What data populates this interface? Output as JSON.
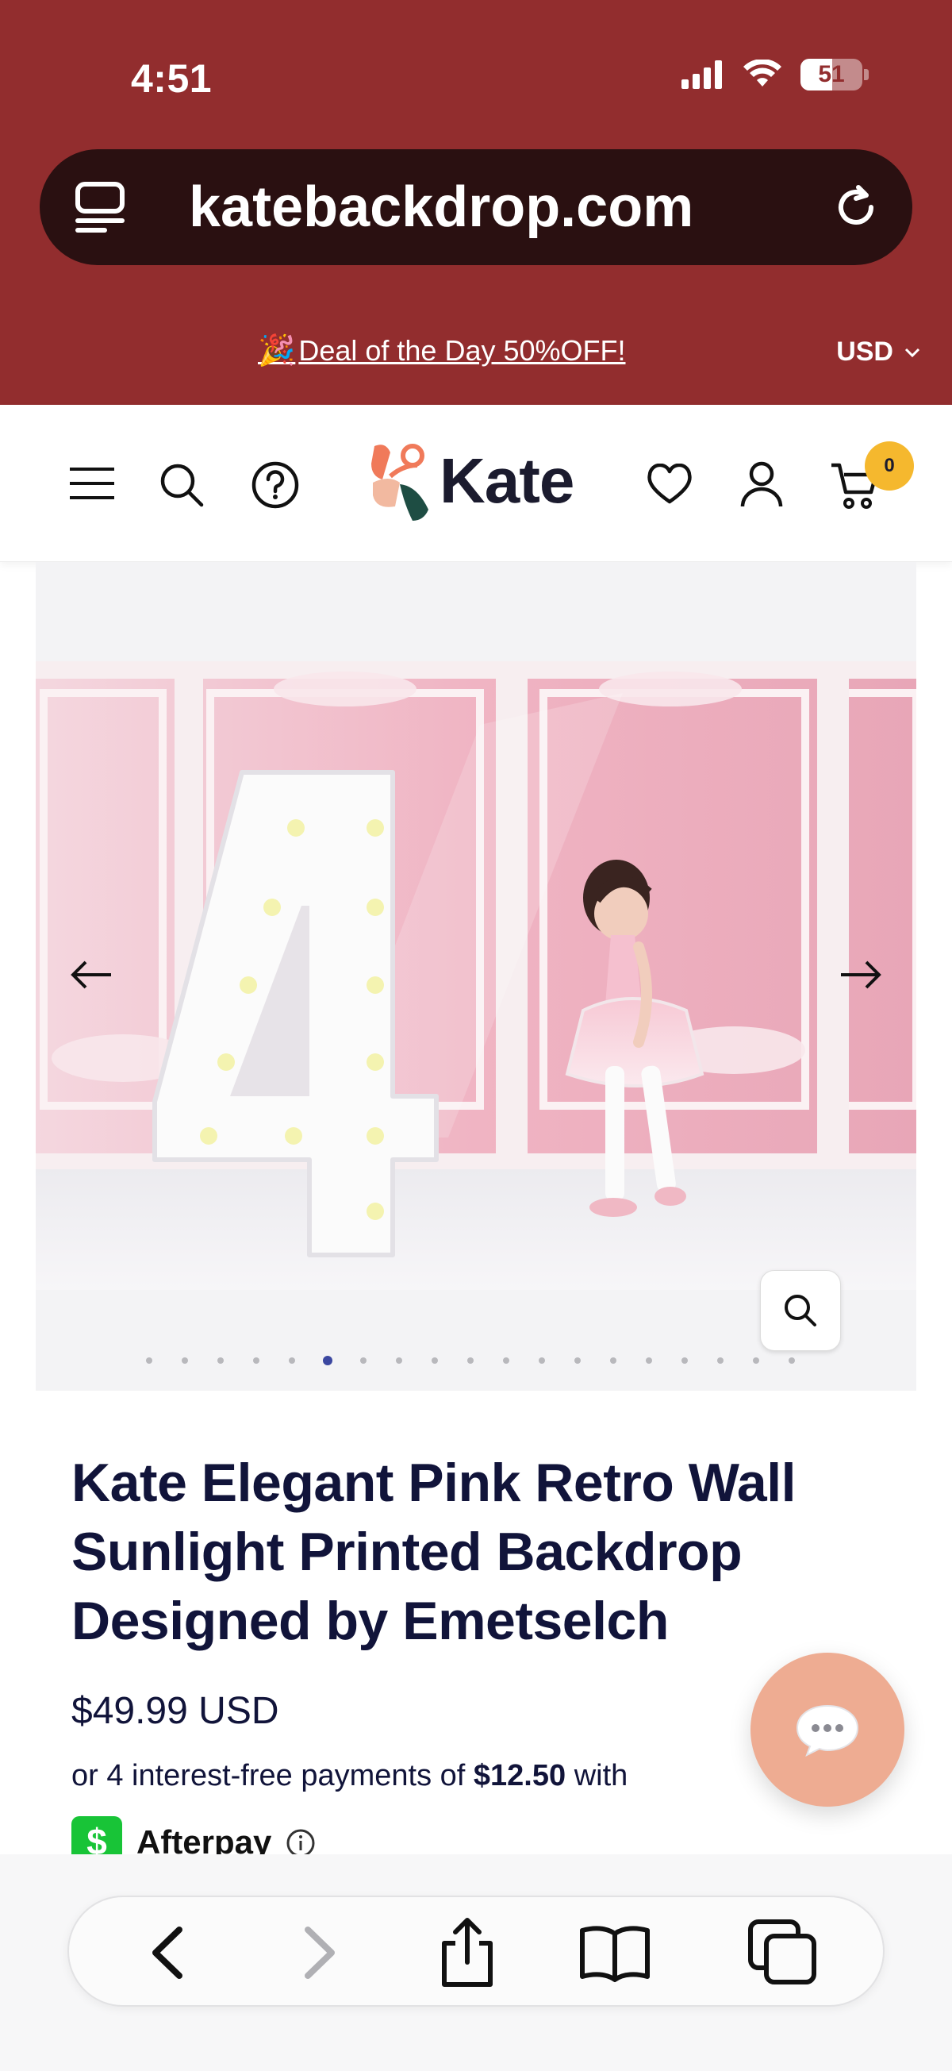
{
  "status_bar": {
    "time": "4:51",
    "battery_level": "51",
    "battery_fraction": 0.51,
    "icons": [
      "signal-icon",
      "wifi-icon",
      "battery-icon"
    ]
  },
  "browser": {
    "url": "katebackdrop.com",
    "icons": [
      "tab-overview-icon",
      "reload-icon"
    ]
  },
  "promo_bar": {
    "text": "Deal of the Day 50%OFF!",
    "emoji_icon": "party-popper-icon",
    "currency": "USD"
  },
  "header": {
    "logo_text": "Kate",
    "cart_count": "0",
    "icons": [
      "menu-icon",
      "search-icon",
      "help-icon",
      "wishlist-icon",
      "account-icon",
      "cart-icon"
    ]
  },
  "gallery": {
    "image_count": 19,
    "active_index": 5,
    "icons": [
      "arrow-left-icon",
      "arrow-right-icon",
      "zoom-icon"
    ]
  },
  "product": {
    "title": "Kate Elegant Pink Retro Wall Sunlight Printed Backdrop Designed by Emetselch",
    "price": "$49.99 USD",
    "installments_prefix": "or 4 interest-free payments of",
    "installments_amount": "$12.50",
    "installments_suffix": "with",
    "afterpay_label": "Afterpay"
  },
  "chat": {
    "icon": "chat-bubble-icon"
  },
  "toolbar": {
    "icons": [
      "back-icon",
      "forward-icon",
      "share-icon",
      "bookmarks-icon",
      "tabs-icon"
    ]
  },
  "colors": {
    "chrome": "#922d2e",
    "url_bar": "#2a1011",
    "title_text": "#11143a",
    "cart_badge": "#f5b82e",
    "active_dot": "#3b47a0",
    "afterpay_green": "#18c437",
    "chat_button": "#eeac92"
  }
}
